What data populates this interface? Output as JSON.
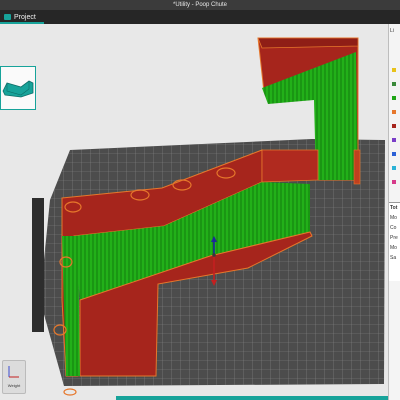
{
  "window": {
    "title": "*Utility - Poop Chute"
  },
  "tabs": [
    {
      "label": "Project"
    }
  ],
  "right_panel": {
    "header": "Li",
    "sub_header": "Tot",
    "lines": [
      "Mo",
      "Co",
      "Pre",
      "Mo",
      "Sa"
    ]
  },
  "viewport": {
    "weight_label": "Weight"
  },
  "colors": {
    "accent": "#17a39a",
    "wall": "#a6251c",
    "edge": "#e6772b",
    "support": "#1fa516",
    "bed": "#4a4a4a",
    "grid": "#9c9c9c"
  },
  "legend_swatches": [
    "#e8c21a",
    "#3a8a3a",
    "#1fa516",
    "#e6772b",
    "#a6251c",
    "#7a3ec8",
    "#2a60d6",
    "#2ab2d6",
    "#d63a8a"
  ]
}
